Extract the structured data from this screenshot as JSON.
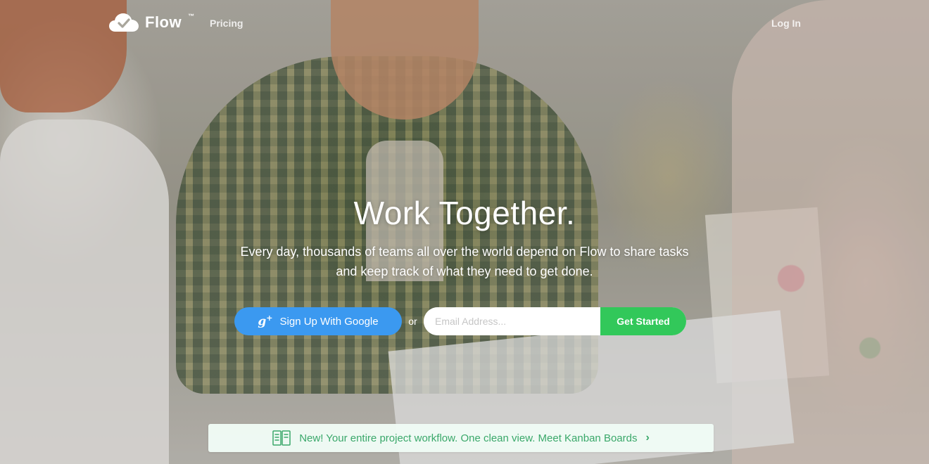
{
  "nav": {
    "logo_text": "Flow",
    "logo_tm": "™",
    "pricing_label": "Pricing",
    "login_label": "Log In"
  },
  "hero": {
    "headline": "Work Together.",
    "subtext": "Every day, thousands of teams all over the world depend on Flow to share tasks and keep track of what they need to get done."
  },
  "signup": {
    "google_button_label": "Sign Up With Google",
    "google_icon": "g+",
    "or_label": "or",
    "email_placeholder": "Email Address...",
    "email_value": "",
    "get_started_label": "Get Started"
  },
  "banner": {
    "text": "New! Your entire project workflow. One clean view. Meet Kanban Boards",
    "arrow": "›"
  },
  "colors": {
    "google_blue": "#3b99f0",
    "get_started_green": "#32c85a",
    "banner_text_green": "#3aa86a",
    "banner_bg": "#f0fcf6"
  },
  "icons": {
    "logo": "cloud-check-icon",
    "google": "google-plus-icon",
    "banner": "kanban-board-icon",
    "banner_arrow": "chevron-right-icon"
  }
}
